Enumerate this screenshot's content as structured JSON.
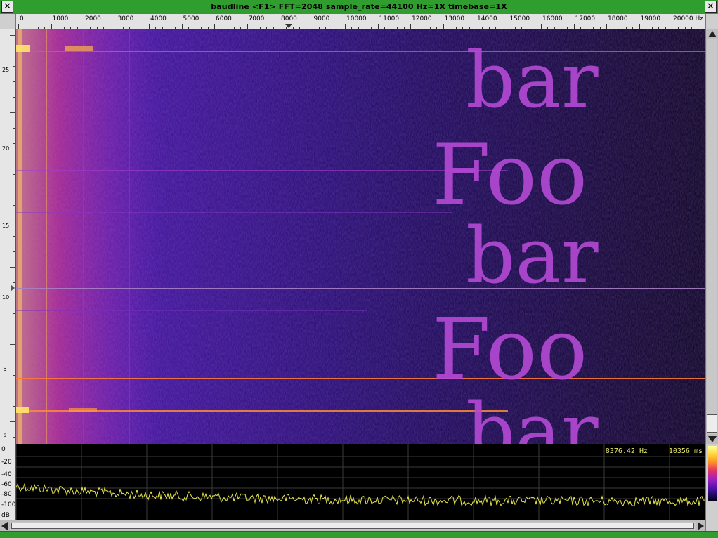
{
  "window": {
    "title": "baudline  <F1> FFT=2048 sample_rate=44100 Hz=1X timebase=1X",
    "close_glyph": "✕",
    "accent_color": "#2f9e2f"
  },
  "freq_axis": {
    "labels": [
      "0",
      "1000",
      "2000",
      "3000",
      "4000",
      "5000",
      "6000",
      "7000",
      "8000",
      "9000",
      "10000",
      "11000",
      "12000",
      "13000",
      "14000",
      "15000",
      "16000",
      "17000",
      "18000",
      "19000",
      "20000"
    ],
    "unit": "Hz"
  },
  "time_axis": {
    "labels": [
      "25",
      "20",
      "15",
      "10",
      "5",
      "s"
    ]
  },
  "spectrogram": {
    "overlay_words": [
      "bar",
      "Foo",
      "bar",
      "Foo",
      "bar"
    ],
    "palette": [
      "#0b0422",
      "#4a12a6",
      "#9a1ec4",
      "#e0326a",
      "#ffc83a"
    ]
  },
  "spectrum": {
    "db_labels": [
      "0",
      "-20",
      "-40",
      "-60",
      "-80",
      "-100",
      "dB"
    ],
    "frequency_readout": "8376.42 Hz",
    "time_readout": "10356 ms",
    "trace_color": "#e8e84a"
  },
  "icons": {
    "close": "close-icon",
    "scroll_up": "arrow-up-icon",
    "scroll_down": "arrow-down-icon",
    "scroll_left": "arrow-left-icon",
    "scroll_right": "arrow-right-icon"
  }
}
